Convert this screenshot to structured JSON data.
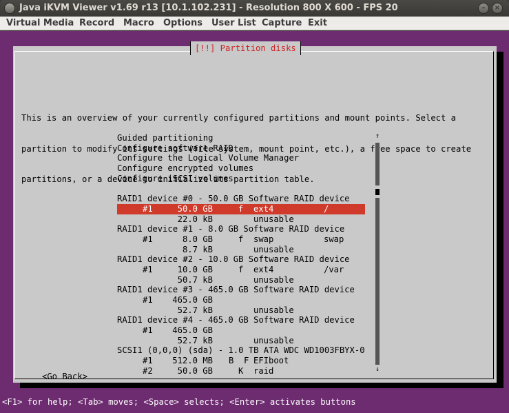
{
  "window": {
    "title": "Java iKVM Viewer v1.69 r13 [10.1.102.231] - Resolution 800 X 600 - FPS 20",
    "minimize_glyph": "–",
    "close_glyph": "×"
  },
  "menubar": {
    "items": [
      "Virtual Media",
      "Record",
      "Macro",
      "Options",
      "User List",
      "Capture",
      "Exit"
    ]
  },
  "dialog": {
    "title": "[!!] Partition disks",
    "intro_lines": [
      "This is an overview of your currently configured partitions and mount points. Select a",
      "partition to modify its settings (file system, mount point, etc.), a free space to create",
      "partitions, or a device to initialize its partition table."
    ],
    "menu_options": [
      "Guided partitioning",
      "Configure software RAID",
      "Configure the Logical Volume Manager",
      "Configure encrypted volumes",
      "Configure iSCSI volumes"
    ],
    "devices": [
      {
        "header": "RAID1 device #0 - 50.0 GB Software RAID device",
        "partitions": [
          {
            "num": "#1",
            "size": "50.0 GB",
            "flag": "f",
            "fs": "ext4",
            "mount": "/",
            "selected": true
          },
          {
            "num": "",
            "size": "22.0 kB",
            "flag": "",
            "fs": "unusable",
            "mount": "",
            "selected": false
          }
        ]
      },
      {
        "header": "RAID1 device #1 - 8.0 GB Software RAID device",
        "partitions": [
          {
            "num": "#1",
            "size": "8.0 GB",
            "flag": "f",
            "fs": "swap",
            "mount": "swap",
            "selected": false
          },
          {
            "num": "",
            "size": "8.7 kB",
            "flag": "",
            "fs": "unusable",
            "mount": "",
            "selected": false
          }
        ]
      },
      {
        "header": "RAID1 device #2 - 10.0 GB Software RAID device",
        "partitions": [
          {
            "num": "#1",
            "size": "10.0 GB",
            "flag": "f",
            "fs": "ext4",
            "mount": "/var",
            "selected": false
          },
          {
            "num": "",
            "size": "50.7 kB",
            "flag": "",
            "fs": "unusable",
            "mount": "",
            "selected": false
          }
        ]
      },
      {
        "header": "RAID1 device #3 - 465.0 GB Software RAID device",
        "partitions": [
          {
            "num": "#1",
            "size": "465.0 GB",
            "flag": "",
            "fs": "",
            "mount": "",
            "selected": false
          },
          {
            "num": "",
            "size": "52.7 kB",
            "flag": "",
            "fs": "unusable",
            "mount": "",
            "selected": false
          }
        ]
      },
      {
        "header": "RAID1 device #4 - 465.0 GB Software RAID device",
        "partitions": [
          {
            "num": "#1",
            "size": "465.0 GB",
            "flag": "",
            "fs": "",
            "mount": "",
            "selected": false
          },
          {
            "num": "",
            "size": "52.7 kB",
            "flag": "",
            "fs": "unusable",
            "mount": "",
            "selected": false
          }
        ]
      },
      {
        "header": "SCSI1 (0,0,0) (sda) - 1.0 TB ATA WDC WD1003FBYX-0",
        "partitions": [
          {
            "num": "#1",
            "size": "512.0 MB",
            "flag": "B  F",
            "fs": "EFIboot",
            "mount": "",
            "selected": false
          },
          {
            "num": "#2",
            "size": "50.0 GB",
            "flag": "K",
            "fs": "raid",
            "mount": "",
            "selected": false
          }
        ]
      }
    ],
    "scroll_up": "↑",
    "scroll_down": "↓",
    "go_back": "<Go Back>"
  },
  "statusbar": {
    "text": "<F1> for help; <Tab> moves; <Space> selects; <Enter> activates buttons"
  },
  "colors": {
    "console_bg": "#6d2c70",
    "dialog_bg": "#c9c9c9",
    "selection_bg": "#d03a2b",
    "title_red": "#cc2222"
  }
}
